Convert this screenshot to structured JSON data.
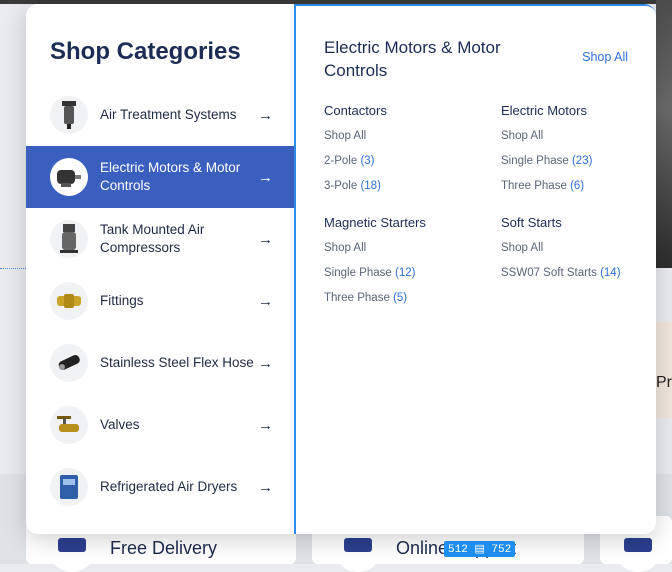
{
  "panel": {
    "heading": "Shop Categories",
    "categories": [
      {
        "label": "Air Treatment Systems",
        "active": false
      },
      {
        "label": "Electric Motors & Motor Controls",
        "active": true
      },
      {
        "label": "Tank Mounted Air Compressors",
        "active": false
      },
      {
        "label": "Fittings",
        "active": false
      },
      {
        "label": "Stainless Steel Flex Hose",
        "active": false
      },
      {
        "label": "Valves",
        "active": false
      },
      {
        "label": "Refrigerated Air Dryers",
        "active": false
      }
    ],
    "arrow": "→"
  },
  "submenu": {
    "title": "Electric Motors & Motor Controls",
    "shop_all": "Shop All",
    "groups": [
      {
        "heading": "Contactors",
        "links": [
          {
            "text": "Shop All",
            "count": ""
          },
          {
            "text": "2-Pole",
            "count": "(3)"
          },
          {
            "text": "3-Pole",
            "count": "(18)"
          }
        ]
      },
      {
        "heading": "Electric Motors",
        "links": [
          {
            "text": "Shop All",
            "count": ""
          },
          {
            "text": "Single Phase ",
            "count": "(23)"
          },
          {
            "text": "Three Phase",
            "count": "(6)"
          }
        ]
      },
      {
        "heading": "Magnetic Starters",
        "links": [
          {
            "text": "Shop All",
            "count": ""
          },
          {
            "text": "Single Phase",
            "count": "(12)"
          },
          {
            "text": "Three Phase",
            "count": "(5)"
          }
        ]
      },
      {
        "heading": "Soft Starts",
        "links": [
          {
            "text": "Shop All",
            "count": ""
          },
          {
            "text": "SSW07 Soft Starts",
            "count": "(14)"
          }
        ]
      }
    ]
  },
  "background": {
    "features": [
      {
        "label": "Free Delivery"
      },
      {
        "label": "Online Support"
      }
    ],
    "right_edge_text": "Pro",
    "dimension_tag": "512 ▤ 752"
  },
  "colors": {
    "active_bg": "#3a5fbf",
    "link_count": "#2e6fd6",
    "focus_border": "#2d8ae6"
  }
}
